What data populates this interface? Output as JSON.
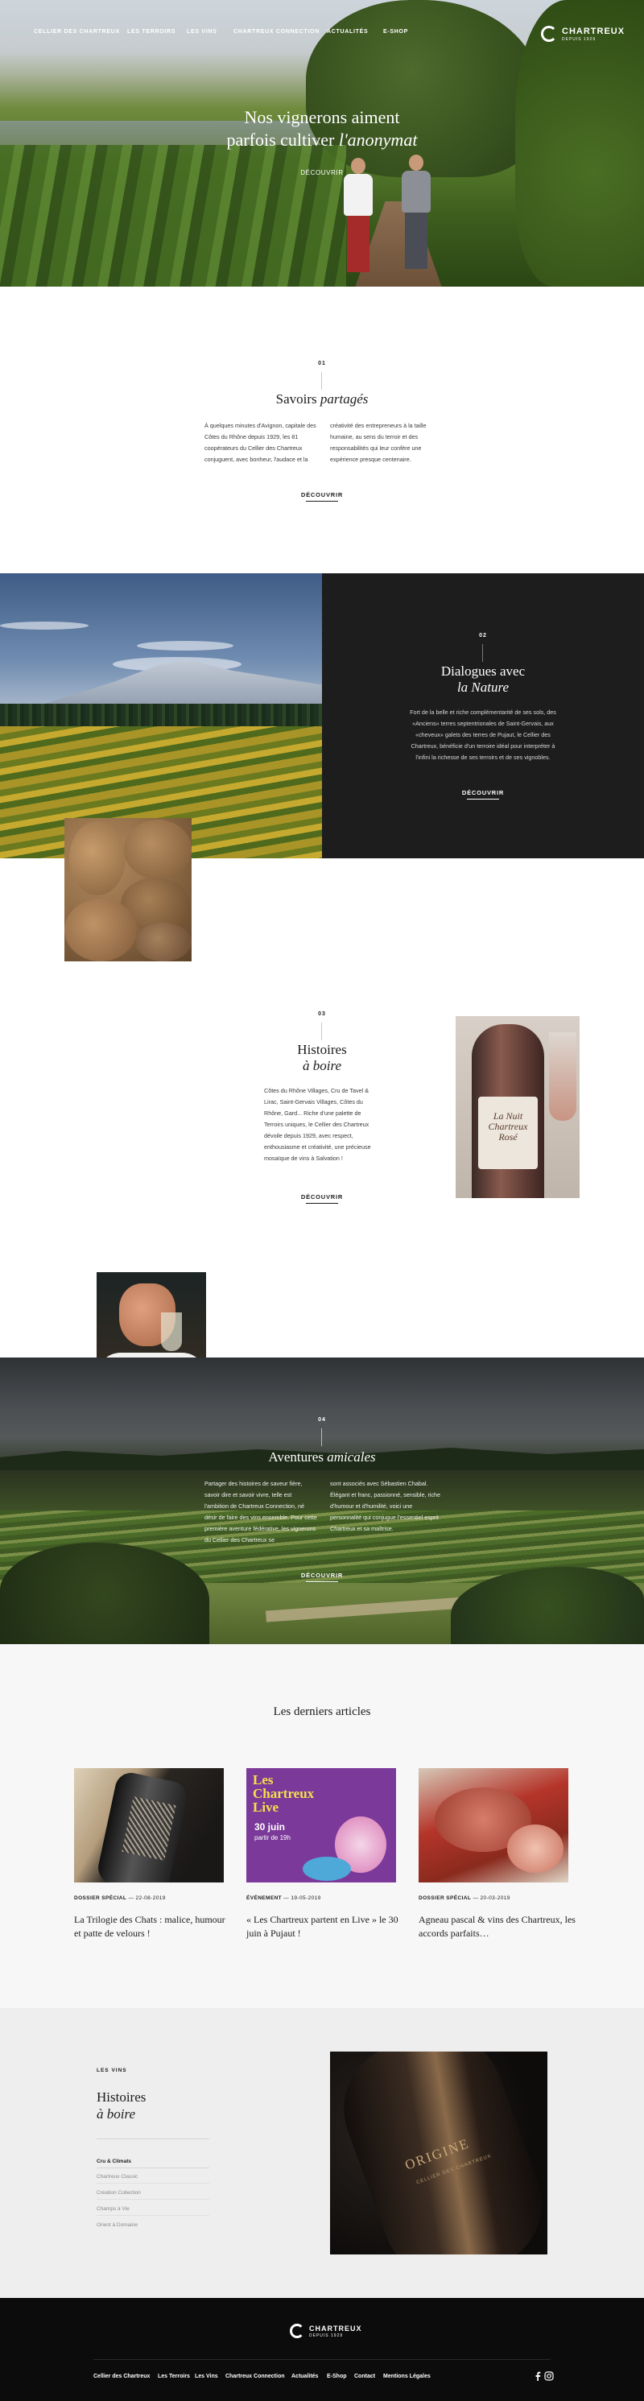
{
  "nav": {
    "items": [
      "Cellier des Chartreux",
      "Les Terroirs",
      "Les Vins",
      "Chartreux Connection",
      "Actualités",
      "E-Shop"
    ]
  },
  "brand": {
    "name": "CHARTREUX",
    "sub": "DEPUIS 1929"
  },
  "hero": {
    "title_line1": "Nos vignerons aiment",
    "title_line2": "parfois cultiver",
    "title_italic": "l'anonymat",
    "link": "DÉCOUVRIR"
  },
  "section1": {
    "number": "01",
    "title": "Savoirs",
    "title_italic": "partagés",
    "col1": "À quelques minutes d'Avignon, capitale des Côtes du Rhône depuis 1929, les 81 coopérateurs du Cellier des Chartreux conjuguent, avec bonheur, l'audace et la",
    "col2": "créativité des entrepreneurs à la taille humaine, au sens du terroir et des responsabilités qui leur confère une expérience presque centenaire.",
    "button": "DÉCOUVRIR"
  },
  "section2": {
    "number": "02",
    "title_line1": "Dialogues avec",
    "title_italic": "la Nature",
    "body": "Fort de la belle et riche complémentarité de ses sols, des «Anciens» terres septentrionales de Saint-Gervais, aux «cheveux» galets des terres de Pujaut, le Cellier des Chartreux, bénéficie d'un terroire idéal pour interpréter à l'infini la richesse de ses terroirs et de ses vignobles.",
    "button": "DÉCOUVRIR"
  },
  "section3": {
    "number": "03",
    "title_line1": "Histoires",
    "title_italic": "à boire",
    "body": "Côtes du Rhône Villages, Cru de Tavel & Lirac, Saint-Gervais Villages, Côtes du Rhône, Gard... Riche d'une palette de Terroirs uniques, le Cellier des Chartreux dévoile depuis 1929, avec respect, enthousiasme et créativité, une précieuse mosaïque de vins à Salvation !",
    "button": "DÉCOUVRIR",
    "bottle_label": "La Nuit Chartreux Rosé"
  },
  "section4": {
    "number": "04",
    "title": "Aventures",
    "title_italic": "amicales",
    "col1": "Partager des histoires de saveur fière, savoir dire et savoir vivre, telle est l'ambition de Chartreux Connection, né désir de faire des vins ensemble. Pour cette première aventure fédérative, les vignerons du Cellier des Chartreux se",
    "col2": "sont associés avec Sébastien Chabal. Élégant et franc, passionné, sensible, riche d'humour et d'humilité, voici une personnalité qui conjugue l'essentiel esprit Chartreux et sa maîtrise.",
    "button": "DÉCOUVRIR"
  },
  "articles": {
    "heading": "Les derniers articles",
    "items": [
      {
        "category": "DOSSIER SPÉCIAL",
        "date": "22-08-2019",
        "title": "La Trilogie des Chats : malice, humour et patte de velours !"
      },
      {
        "category": "ÉVÉNEMENT",
        "date": "19-05-2019",
        "title": "« Les Chartreux partent en Live » le 30 juin à Pujaut !"
      },
      {
        "category": "DOSSIER SPÉCIAL",
        "date": "20-03-2019",
        "title": "Agneau pascal & vins des Chartreux, les accords parfaits…"
      }
    ],
    "poster": {
      "line1": "Les",
      "line2": "Chartreux",
      "line3": "Live",
      "line4": "30 juin",
      "line5": "partir de 19h"
    }
  },
  "wines": {
    "label": "LES VINS",
    "title_line1": "Histoires",
    "title_italic": "à boire",
    "list": [
      "Cru & Climats",
      "Chartreux Classic",
      "Création Collection",
      "Champs à Vie",
      "Orient à Domaine"
    ],
    "bottle_label": "ORIGINE",
    "bottle_sub": "CELLIER DES CHARTREUX"
  },
  "footer": {
    "links": [
      "Cellier des Chartreux",
      "Les Terroirs",
      "Les Vins",
      "Chartreux Connection",
      "Actualités",
      "E-Shop",
      "Contact",
      "Mentions Légales"
    ],
    "icons": [
      "facebook-icon",
      "instagram-icon"
    ]
  },
  "colors": {
    "dark": "#1d1d1d",
    "light_gray": "#f7f7f7",
    "footer": "#0c0c0c",
    "text": "#1c1c1c"
  }
}
